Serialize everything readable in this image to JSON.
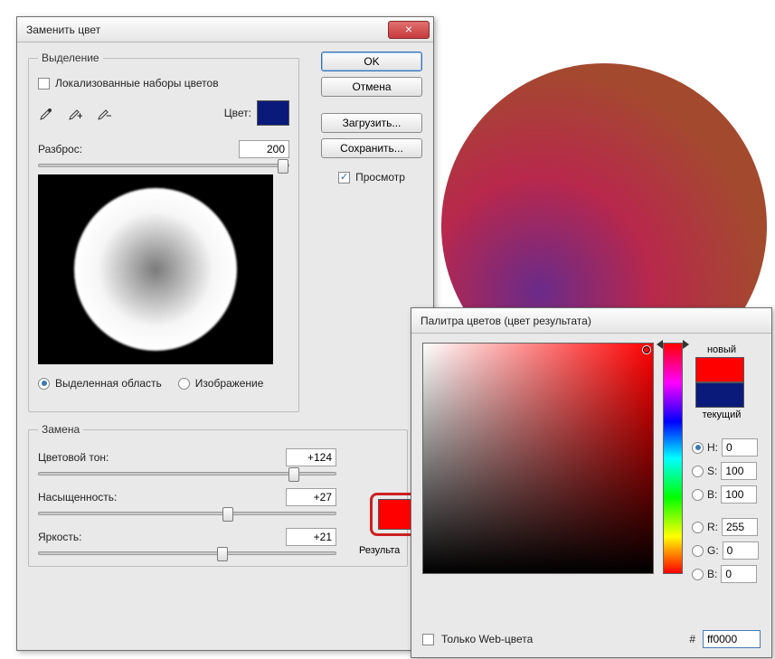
{
  "replace": {
    "title": "Заменить цвет",
    "selection_legend": "Выделение",
    "localized_sets": "Локализованные наборы цветов",
    "color_label": "Цвет:",
    "source_color": "#0a1a7a",
    "fuzziness_label": "Разброс:",
    "fuzziness_value": "200",
    "radio_selection": "Выделенная область",
    "radio_image": "Изображение",
    "replace_legend": "Замена",
    "hue_label": "Цветовой тон:",
    "hue_value": "+124",
    "sat_label": "Насыщенность:",
    "sat_value": "+27",
    "light_label": "Яркость:",
    "light_value": "+21",
    "result_label": "Результа",
    "result_color": "#ff0000",
    "buttons": {
      "ok": "OK",
      "cancel": "Отмена",
      "load": "Загрузить...",
      "save": "Сохранить..."
    },
    "preview_label": "Просмотр"
  },
  "picker": {
    "title": "Палитра цветов (цвет результата)",
    "new_label": "новый",
    "current_label": "текущий",
    "new_color": "#ff0000",
    "current_color": "#0a1a7a",
    "h_label": "H:",
    "h_val": "0",
    "s_label": "S:",
    "s_val": "100",
    "b_label": "B:",
    "b_val": "100",
    "r_label": "R:",
    "r_val": "255",
    "g_label": "G:",
    "g_val": "0",
    "bb_label": "B:",
    "bb_val": "0",
    "web_only": "Только Web-цвета",
    "hex_label": "#",
    "hex_value": "ff0000"
  }
}
